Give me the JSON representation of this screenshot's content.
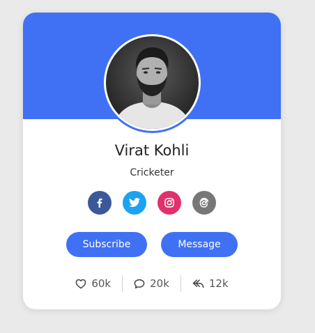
{
  "profile": {
    "name": "Virat Kohli",
    "role": "Cricketer"
  },
  "socials": [
    {
      "name": "facebook",
      "icon": "facebook-icon",
      "color": "#3b5998"
    },
    {
      "name": "twitter",
      "icon": "twitter-icon",
      "color": "#1da1f2"
    },
    {
      "name": "instagram",
      "icon": "instagram-icon",
      "color": "#e1306c"
    },
    {
      "name": "threads",
      "icon": "threads-icon",
      "color": "#777777"
    }
  ],
  "buttons": {
    "subscribe": "Subscribe",
    "message": "Message"
  },
  "stats": {
    "likes": "60k",
    "comments": "20k",
    "shares": "12k"
  },
  "colors": {
    "accent": "#4070f4",
    "button_text": "#ffffff"
  }
}
